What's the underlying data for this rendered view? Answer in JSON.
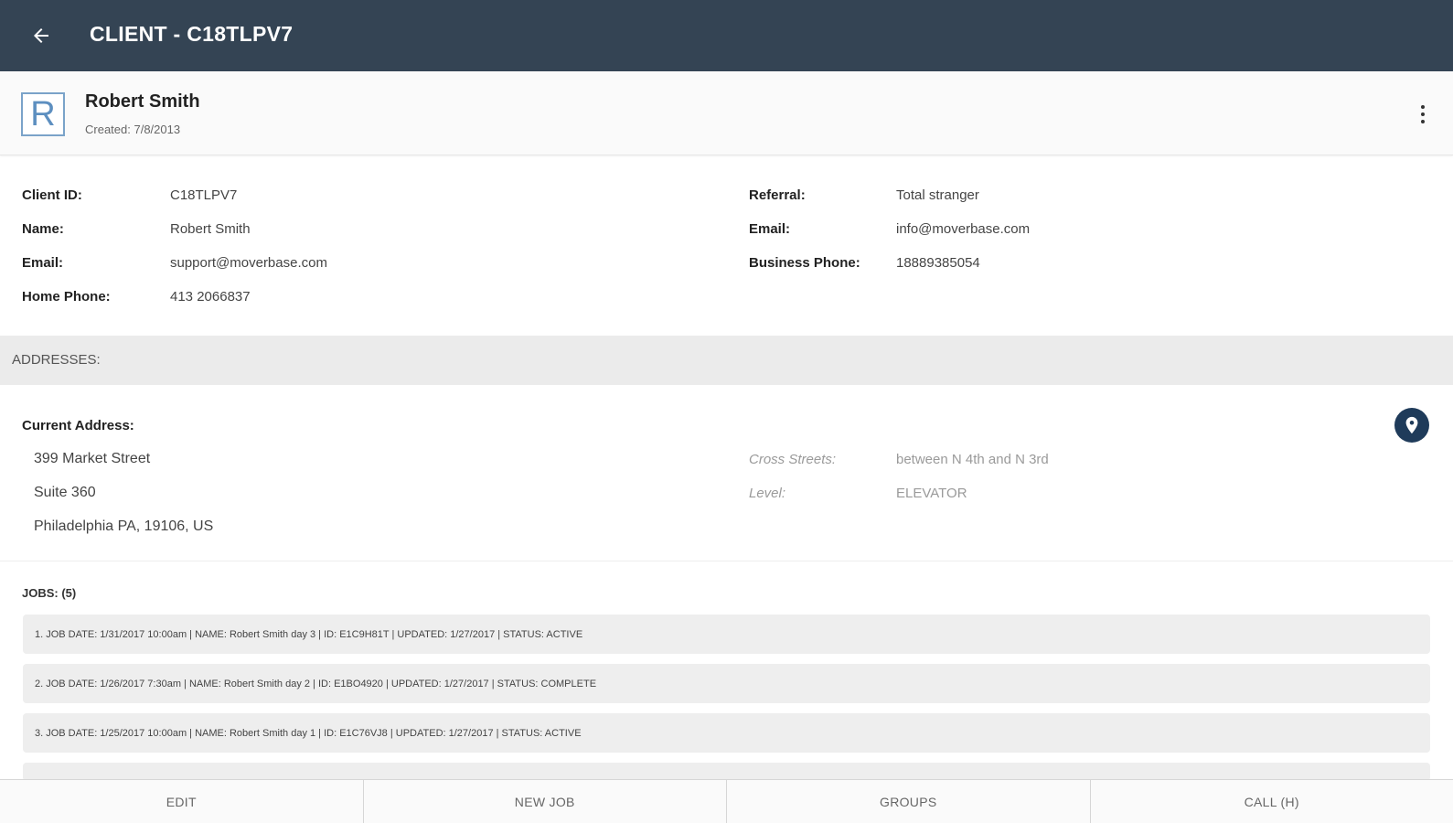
{
  "appbar": {
    "title": "CLIENT - C18TLPV7",
    "back_icon": "arrow-left-icon"
  },
  "client": {
    "avatar_letter": "R",
    "name": "Robert Smith",
    "created": "Created: 7/8/2013"
  },
  "info": {
    "left": [
      {
        "label": "Client ID:",
        "value": "C18TLPV7"
      },
      {
        "label": "Name:",
        "value": "Robert Smith"
      },
      {
        "label": "Email:",
        "value": "support@moverbase.com"
      },
      {
        "label": "Home Phone:",
        "value": "413 2066837"
      }
    ],
    "right": [
      {
        "label": "Referral:",
        "value": "Total stranger"
      },
      {
        "label": "Email:",
        "value": "info@moverbase.com"
      },
      {
        "label": "Business Phone:",
        "value": "18889385054"
      }
    ]
  },
  "addresses": {
    "section_title": "ADDRESSES:",
    "current_label": "Current Address:",
    "lines": [
      "399 Market Street",
      "Suite 360",
      "Philadelphia PA, 19106, US"
    ],
    "cross_streets_label": "Cross Streets:",
    "cross_streets_value": "between N 4th and N 3rd",
    "level_label": "Level:",
    "level_value": "ELEVATOR"
  },
  "jobs": {
    "title": "JOBS: (5)",
    "items": [
      "1. JOB DATE: 1/31/2017 10:00am | NAME: Robert Smith day 3 | ID: E1C9H81T | UPDATED: 1/27/2017 | STATUS: ACTIVE",
      "2. JOB DATE: 1/26/2017 7:30am | NAME: Robert Smith day 2 | ID: E1BO4920 | UPDATED: 1/27/2017 | STATUS: COMPLETE",
      "3. JOB DATE: 1/25/2017 10:00am | NAME: Robert Smith day 1 | ID: E1C76VJ8 | UPDATED: 1/27/2017 | STATUS: ACTIVE"
    ]
  },
  "bottom_bar": {
    "edit": "EDIT",
    "new_job": "NEW JOB",
    "groups": "GROUPS",
    "call": "CALL (H)"
  },
  "colors": {
    "appbar": "#344454",
    "pin_button": "#1f3b5a",
    "avatar_border": "#7aa3c9"
  }
}
